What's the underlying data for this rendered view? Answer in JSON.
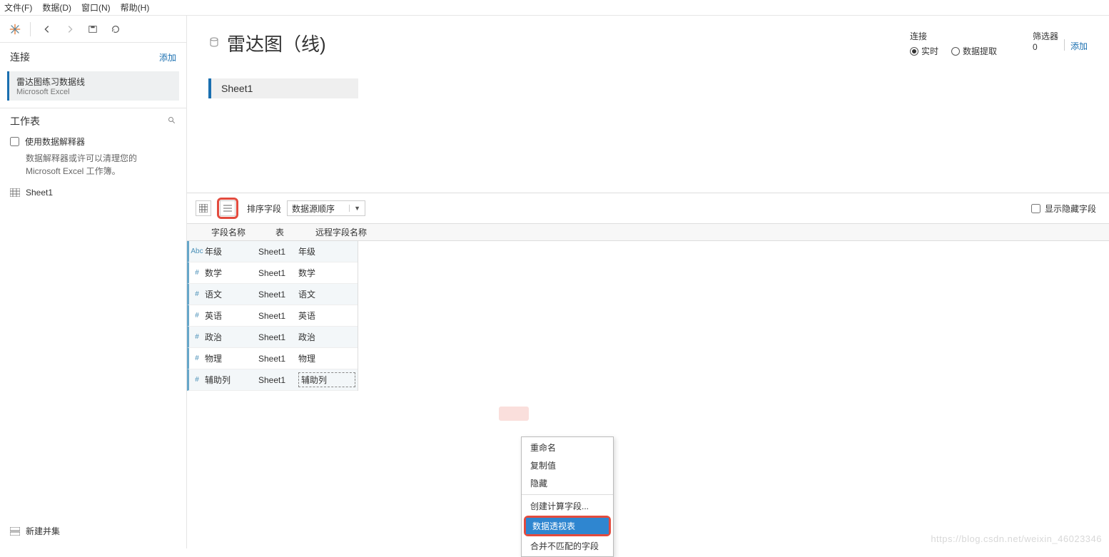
{
  "menubar": {
    "file": "文件(F)",
    "data": "数据(D)",
    "window": "窗口(N)",
    "help": "帮助(H)"
  },
  "sidebar": {
    "conn_title": "连接",
    "add": "添加",
    "conn_name": "雷达图练习数据线",
    "conn_type": "Microsoft Excel",
    "wk_title": "工作表",
    "interp_label": "使用数据解释器",
    "interp_hint": "数据解释器或许可以清理您的 Microsoft Excel 工作簿。",
    "sheet1": "Sheet1",
    "union": "新建并集"
  },
  "header": {
    "title": "雷达图（线)",
    "conn_label": "连接",
    "live": "实时",
    "extract": "数据提取",
    "filter_label": "筛选器",
    "filter_count": "0",
    "filter_add": "添加"
  },
  "canvas": {
    "sheet": "Sheet1"
  },
  "grid_tb": {
    "sort_label": "排序字段",
    "sort_value": "数据源顺序",
    "show_hidden": "显示隐藏字段"
  },
  "ft_head": {
    "fname": "字段名称",
    "table": "表",
    "remote": "远程字段名称"
  },
  "rows": [
    {
      "type": "Abc",
      "fname": "年级",
      "table": "Sheet1",
      "remote": "年级"
    },
    {
      "type": "#",
      "fname": "数学",
      "table": "Sheet1",
      "remote": "数学"
    },
    {
      "type": "#",
      "fname": "语文",
      "table": "Sheet1",
      "remote": "语文"
    },
    {
      "type": "#",
      "fname": "英语",
      "table": "Sheet1",
      "remote": "英语"
    },
    {
      "type": "#",
      "fname": "政治",
      "table": "Sheet1",
      "remote": "政治"
    },
    {
      "type": "#",
      "fname": "物理",
      "table": "Sheet1",
      "remote": "物理"
    },
    {
      "type": "#",
      "fname": "辅助列",
      "table": "Sheet1",
      "remote": "辅助列"
    }
  ],
  "ctx": {
    "rename": "重命名",
    "copy": "复制值",
    "hide": "隐藏",
    "calc": "创建计算字段...",
    "pivot": "数据透视表",
    "merge": "合并不匹配的字段"
  },
  "watermark": "https://blog.csdn.net/weixin_46023346"
}
